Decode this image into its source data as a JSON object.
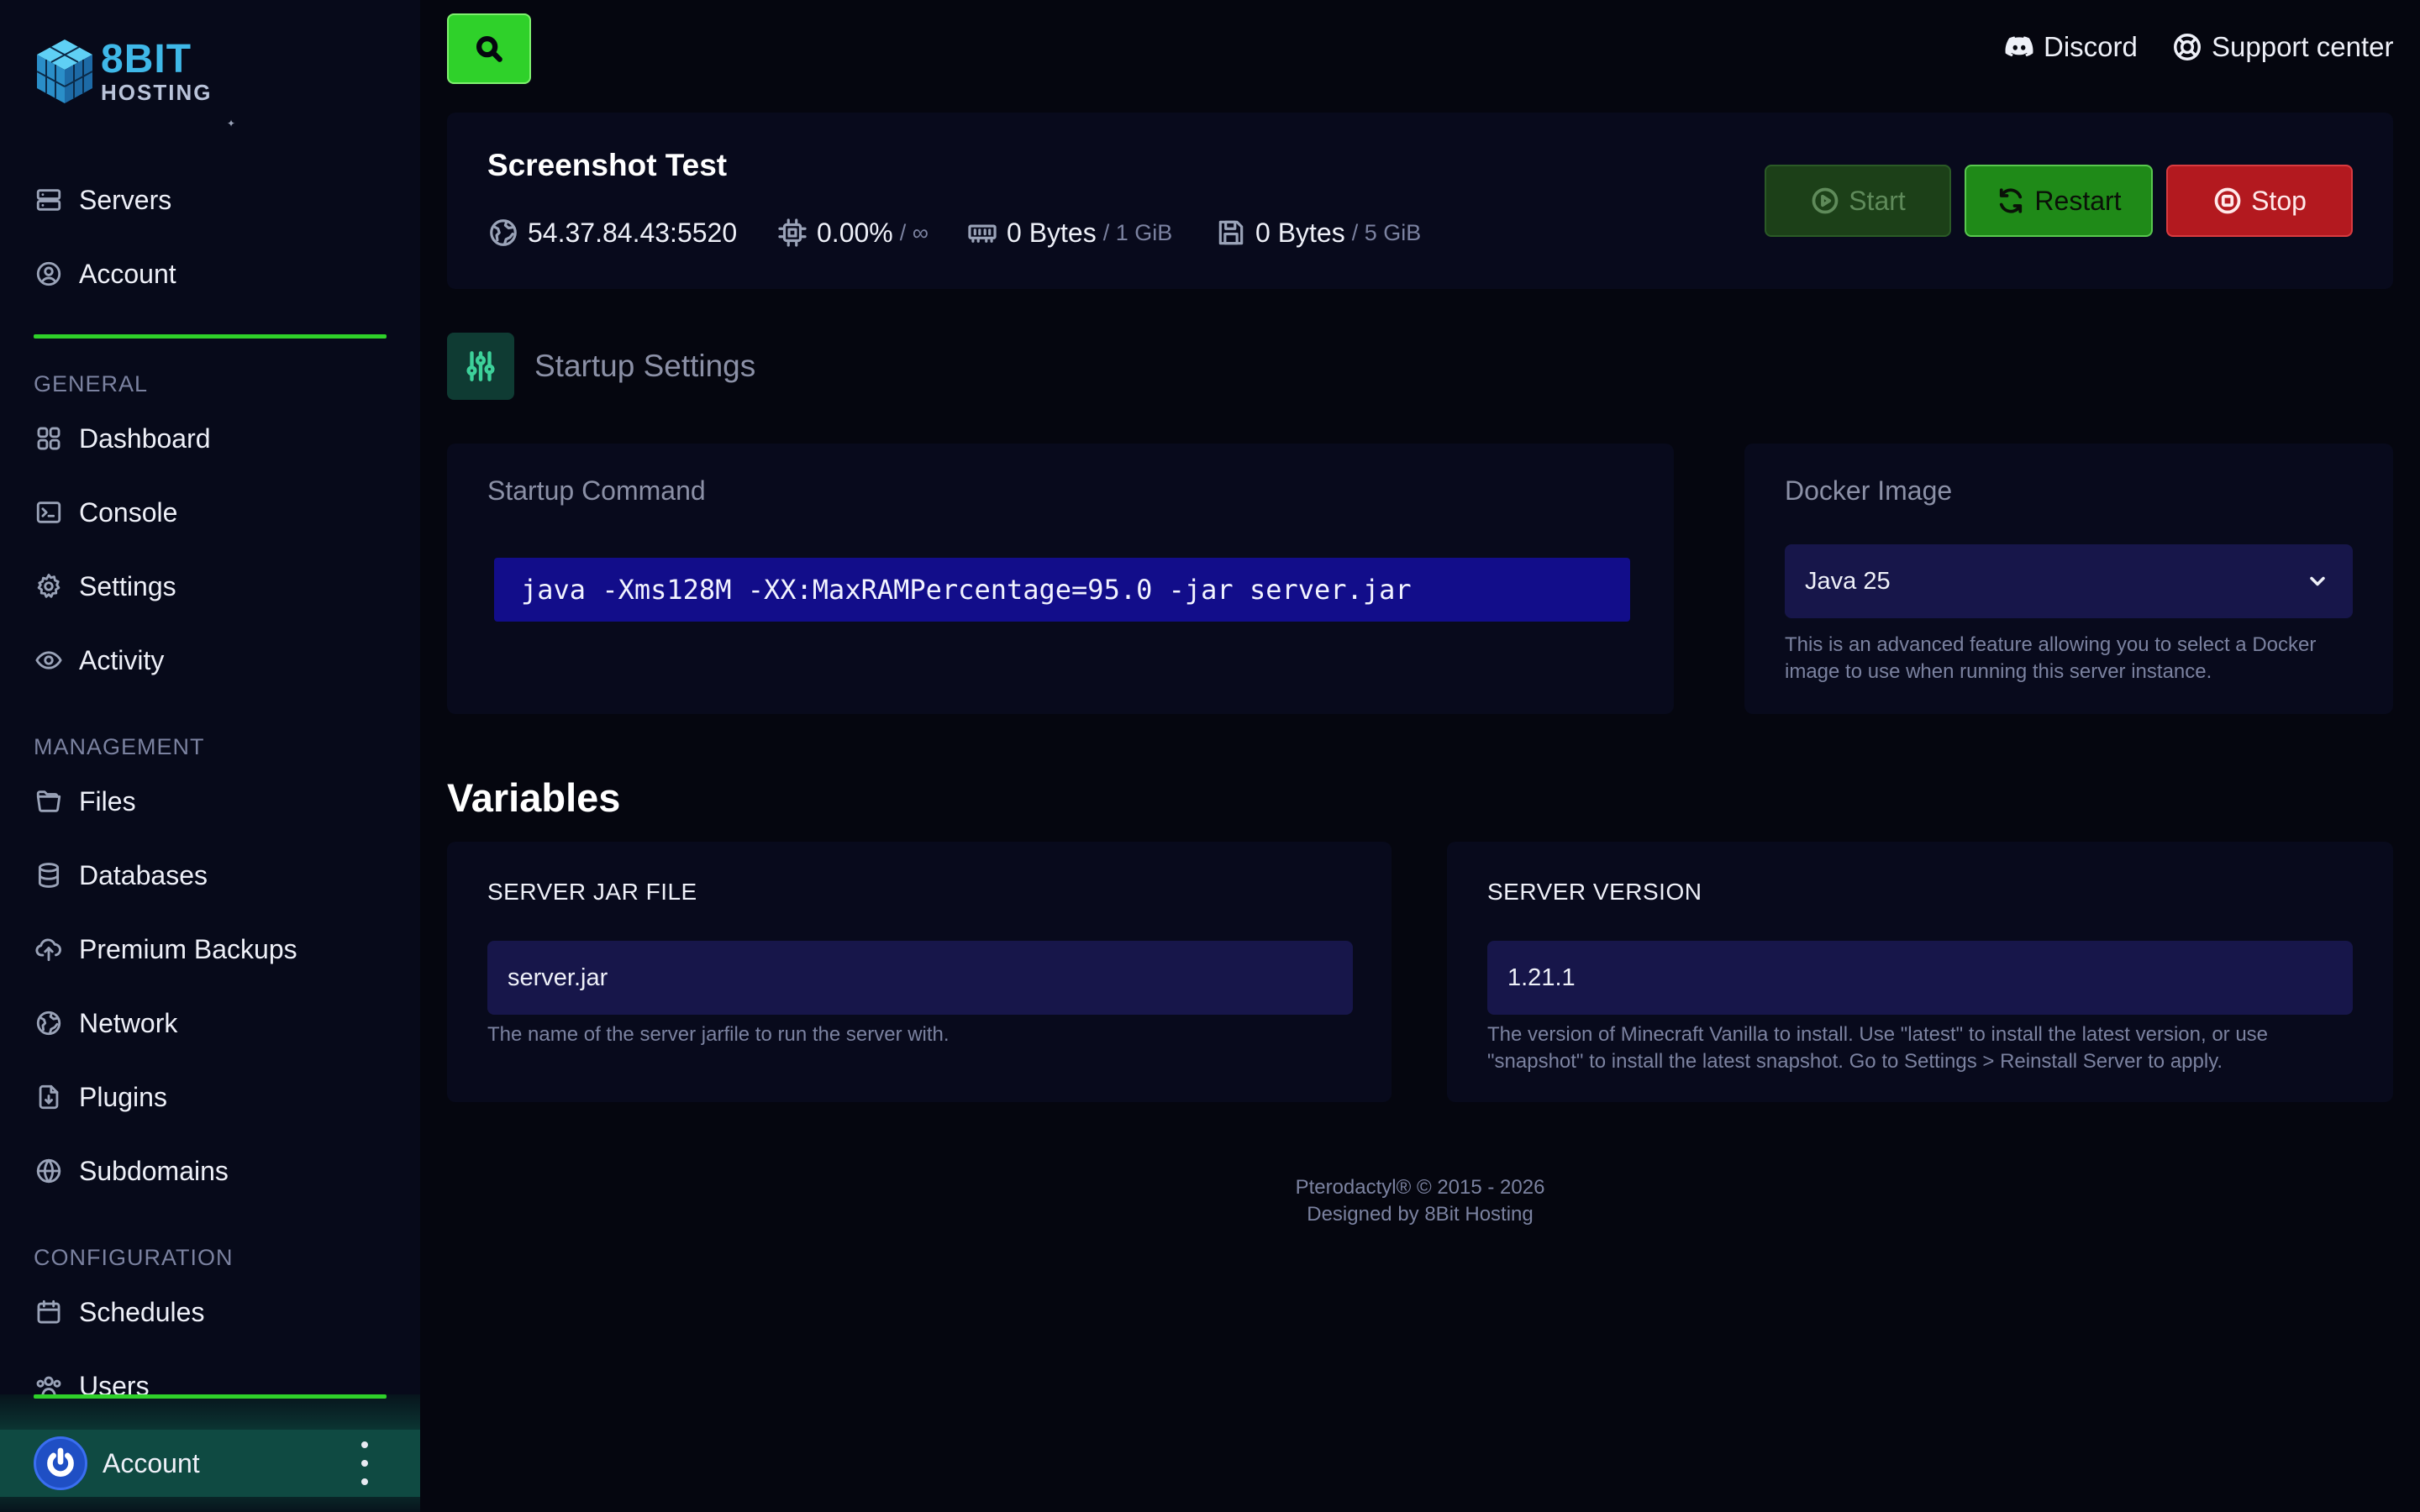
{
  "brand": {
    "logo_line1": "8BIT",
    "logo_line2": "HOSTING"
  },
  "sidebar": {
    "top_items": [
      {
        "label": "Servers",
        "icon": "server-icon"
      },
      {
        "label": "Account",
        "icon": "user-circle-icon"
      }
    ],
    "sections": [
      {
        "title": "GENERAL",
        "items": [
          {
            "label": "Dashboard",
            "icon": "grid-icon"
          },
          {
            "label": "Console",
            "icon": "terminal-icon"
          },
          {
            "label": "Settings",
            "icon": "gear-icon"
          },
          {
            "label": "Activity",
            "icon": "eye-icon"
          }
        ]
      },
      {
        "title": "MANAGEMENT",
        "items": [
          {
            "label": "Files",
            "icon": "folder-icon"
          },
          {
            "label": "Databases",
            "icon": "database-icon"
          },
          {
            "label": "Premium Backups",
            "icon": "cloud-upload-icon"
          },
          {
            "label": "Network",
            "icon": "globe-network-icon"
          },
          {
            "label": "Plugins",
            "icon": "file-download-icon"
          },
          {
            "label": "Subdomains",
            "icon": "globe-icon"
          }
        ]
      },
      {
        "title": "CONFIGURATION",
        "items": [
          {
            "label": "Schedules",
            "icon": "calendar-icon"
          },
          {
            "label": "Users",
            "icon": "users-icon"
          }
        ]
      }
    ],
    "account": {
      "label": "Account"
    }
  },
  "header": {
    "discord_label": "Discord",
    "support_label": "Support center"
  },
  "server": {
    "name": "Screenshot Test",
    "address": "54.37.84.43:5520",
    "cpu": "0.00%",
    "cpu_limit": "/ ∞",
    "memory": "0 Bytes",
    "memory_limit": "/ 1 GiB",
    "disk": "0 Bytes",
    "disk_limit": "/ 5 GiB",
    "buttons": {
      "start": "Start",
      "restart": "Restart",
      "stop": "Stop"
    }
  },
  "startup": {
    "section_title": "Startup Settings",
    "command_label": "Startup Command",
    "command": "java -Xms128M -XX:MaxRAMPercentage=95.0 -jar server.jar",
    "docker_label": "Docker Image",
    "docker_value": "Java 25",
    "docker_help_1": "This is an advanced feature allowing you to select a Docker",
    "docker_help_2": "image to use when running this server instance."
  },
  "variables": {
    "title": "Variables",
    "items": [
      {
        "label": "SERVER JAR FILE",
        "value": "server.jar",
        "help_1": "The name of the server jarfile to run the server with.",
        "help_2": ""
      },
      {
        "label": "SERVER VERSION",
        "value": "1.21.1",
        "help_1": "The version of Minecraft Vanilla to install. Use \"latest\" to install the latest version, or use",
        "help_2": "\"snapshot\" to install the latest snapshot. Go to Settings > Reinstall Server to apply."
      }
    ]
  },
  "footer": {
    "line1": "Pterodactyl® © 2015 - 2026",
    "line2": "Designed by 8Bit Hosting"
  },
  "colors": {
    "background": "#05060f",
    "sidebar": "#070a1a",
    "accent_green": "#2fd12a",
    "input_bg": "#17164a",
    "command_bg": "#120d8a",
    "stop_red": "#b3191f"
  }
}
